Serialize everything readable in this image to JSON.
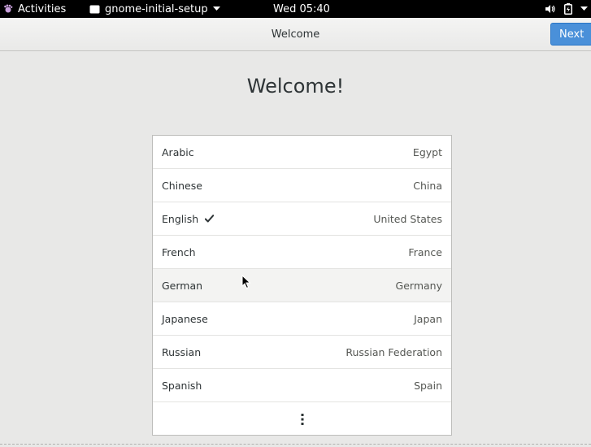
{
  "topbar": {
    "activities_label": "Activities",
    "app_menu_label": "gnome-initial-setup",
    "clock": "Wed 05:40"
  },
  "header": {
    "title": "Welcome",
    "next_label": "Next"
  },
  "main": {
    "welcome_title": "Welcome!",
    "languages": [
      {
        "language": "Arabic",
        "region": "Egypt",
        "selected": false
      },
      {
        "language": "Chinese",
        "region": "China",
        "selected": false
      },
      {
        "language": "English",
        "region": "United States",
        "selected": true
      },
      {
        "language": "French",
        "region": "France",
        "selected": false
      },
      {
        "language": "German",
        "region": "Germany",
        "selected": false
      },
      {
        "language": "Japanese",
        "region": "Japan",
        "selected": false
      },
      {
        "language": "Russian",
        "region": "Russian Federation",
        "selected": false
      },
      {
        "language": "Spanish",
        "region": "Spain",
        "selected": false
      }
    ]
  },
  "colors": {
    "accent": "#4a90d9",
    "topbar": "#000000",
    "background": "#e8e8e7"
  }
}
